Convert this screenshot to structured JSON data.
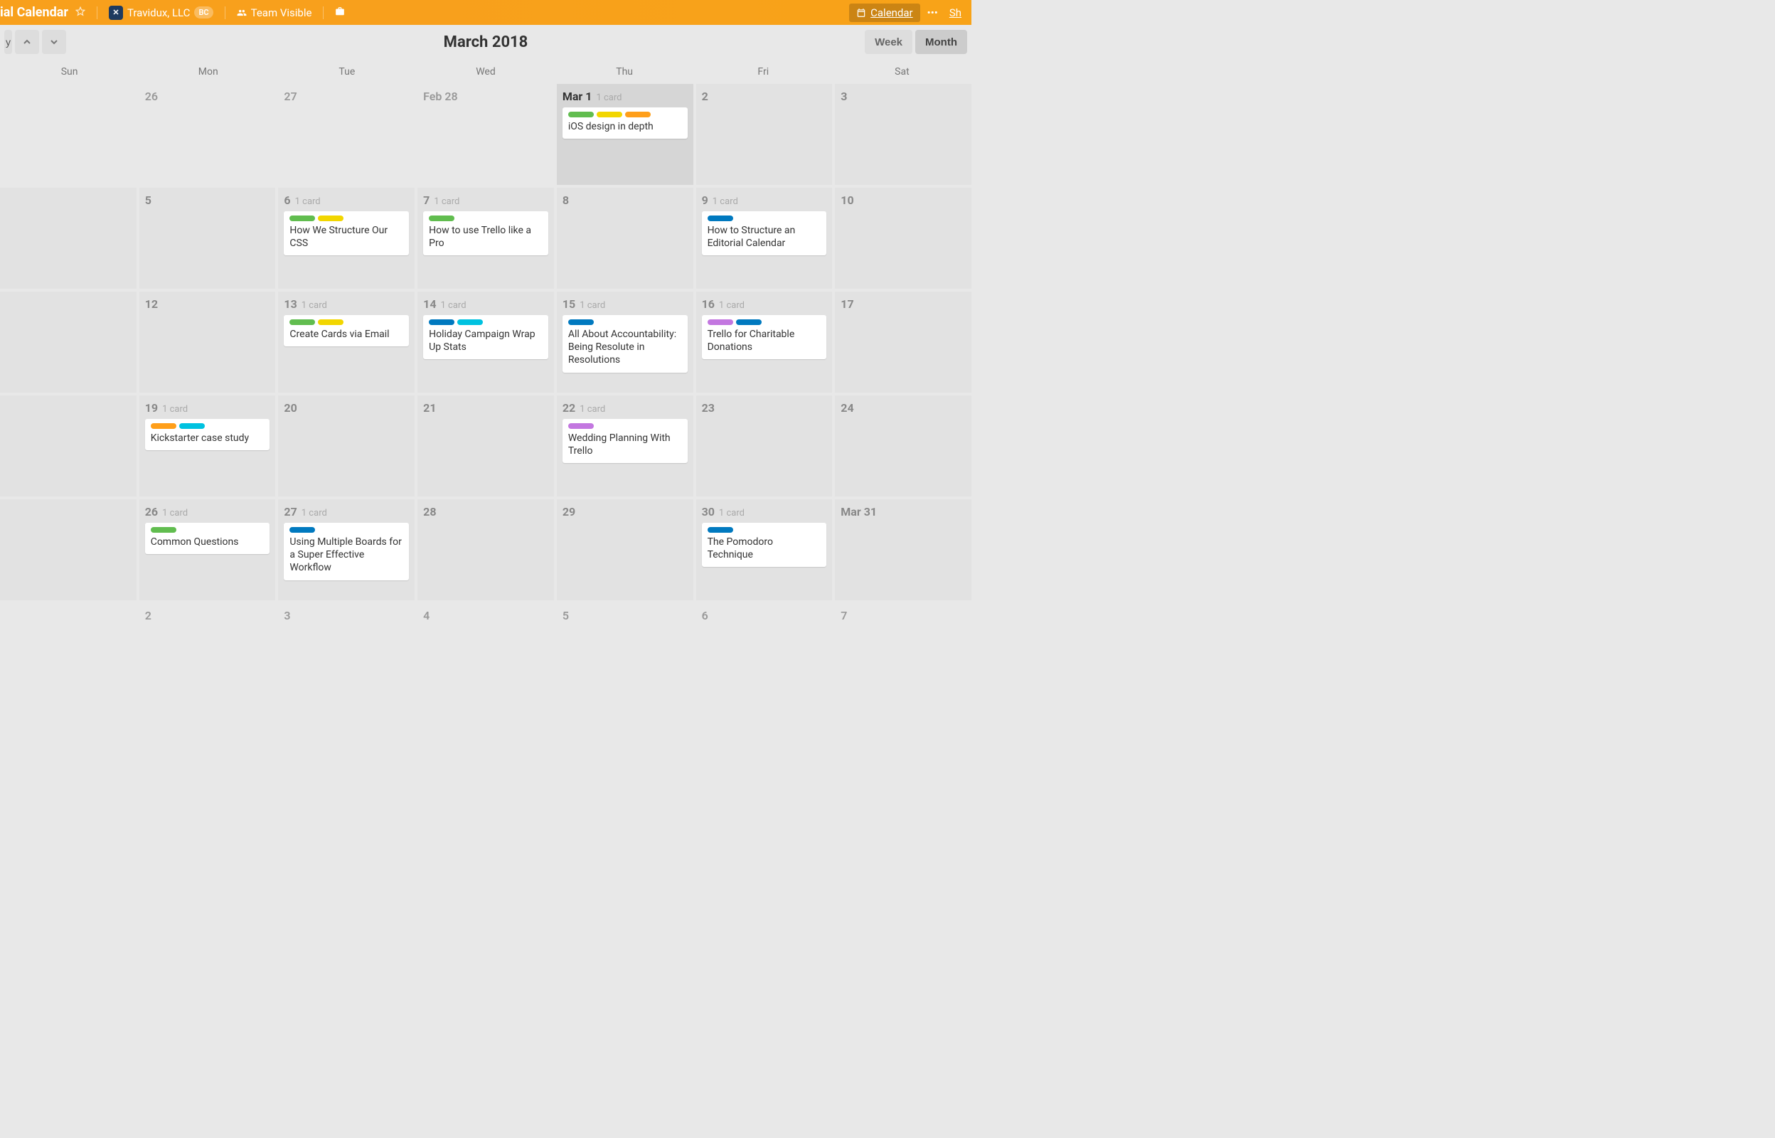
{
  "header": {
    "board_name": "ial Calendar",
    "team_name": "Travidux, LLC",
    "bc": "BC",
    "visibility": "Team Visible",
    "calendar_btn": "Calendar",
    "share_btn": "Sh"
  },
  "toolbar": {
    "today": "y",
    "title": "March 2018",
    "week": "Week",
    "month": "Month"
  },
  "day_headers": [
    "Sun",
    "Mon",
    "Tue",
    "Wed",
    "Thu",
    "Fri",
    "Sat"
  ],
  "label_colors": {
    "g": "green",
    "y": "yellow",
    "o": "orange",
    "b": "blue",
    "t": "teal",
    "p": "purple"
  },
  "cells": [
    {
      "date": "",
      "out": true
    },
    {
      "date": "26",
      "out": true
    },
    {
      "date": "27",
      "out": true
    },
    {
      "date": "Feb 28",
      "out": true
    },
    {
      "date": "Mar 1",
      "count": "1 card",
      "today": true,
      "cards": [
        {
          "labels": [
            "g",
            "y",
            "o"
          ],
          "title": "iOS design in depth"
        }
      ]
    },
    {
      "date": "2"
    },
    {
      "date": "3"
    },
    {
      "date": ""
    },
    {
      "date": "5"
    },
    {
      "date": "6",
      "count": "1 card",
      "cards": [
        {
          "labels": [
            "g",
            "y"
          ],
          "title": "How We Structure Our CSS"
        }
      ]
    },
    {
      "date": "7",
      "count": "1 card",
      "cards": [
        {
          "labels": [
            "g"
          ],
          "title": "How to use Trello like a Pro"
        }
      ]
    },
    {
      "date": "8"
    },
    {
      "date": "9",
      "count": "1 card",
      "cards": [
        {
          "labels": [
            "b"
          ],
          "title": "How to Structure an Editorial Calendar"
        }
      ]
    },
    {
      "date": "10"
    },
    {
      "date": ""
    },
    {
      "date": "12"
    },
    {
      "date": "13",
      "count": "1 card",
      "cards": [
        {
          "labels": [
            "g",
            "y"
          ],
          "title": "Create Cards via Email"
        }
      ]
    },
    {
      "date": "14",
      "count": "1 card",
      "cards": [
        {
          "labels": [
            "b",
            "t"
          ],
          "title": "Holiday Campaign Wrap Up Stats"
        }
      ]
    },
    {
      "date": "15",
      "count": "1 card",
      "cards": [
        {
          "labels": [
            "b"
          ],
          "title": "All About Accountability: Being Resolute in Resolutions"
        }
      ]
    },
    {
      "date": "16",
      "count": "1 card",
      "cards": [
        {
          "labels": [
            "p",
            "b"
          ],
          "title": "Trello for Charitable Donations"
        }
      ]
    },
    {
      "date": "17"
    },
    {
      "date": ""
    },
    {
      "date": "19",
      "count": "1 card",
      "cards": [
        {
          "labels": [
            "o",
            "t"
          ],
          "title": "Kickstarter case study"
        }
      ]
    },
    {
      "date": "20"
    },
    {
      "date": "21"
    },
    {
      "date": "22",
      "count": "1 card",
      "cards": [
        {
          "labels": [
            "p"
          ],
          "title": "Wedding Planning With Trello"
        }
      ]
    },
    {
      "date": "23"
    },
    {
      "date": "24"
    },
    {
      "date": ""
    },
    {
      "date": "26",
      "count": "1 card",
      "cards": [
        {
          "labels": [
            "g"
          ],
          "title": "Common Questions"
        }
      ]
    },
    {
      "date": "27",
      "count": "1 card",
      "cards": [
        {
          "labels": [
            "b"
          ],
          "title": "Using Multiple Boards for a Super Effective Workflow"
        }
      ]
    },
    {
      "date": "28"
    },
    {
      "date": "29"
    },
    {
      "date": "30",
      "count": "1 card",
      "cards": [
        {
          "labels": [
            "b"
          ],
          "title": "The Pomodoro Technique"
        }
      ]
    },
    {
      "date": "Mar 31"
    },
    {
      "date": "",
      "out": true
    },
    {
      "date": "2",
      "out": true
    },
    {
      "date": "3",
      "out": true
    },
    {
      "date": "4",
      "out": true
    },
    {
      "date": "5",
      "out": true
    },
    {
      "date": "6",
      "out": true
    },
    {
      "date": "7",
      "out": true
    }
  ]
}
